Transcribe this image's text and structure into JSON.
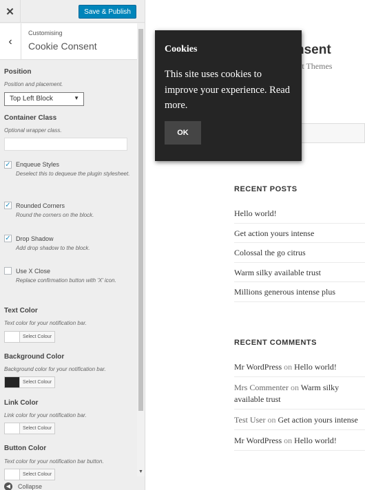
{
  "topbar": {
    "publish_label": "Save & Publish"
  },
  "header": {
    "crumb": "Customising",
    "title": "Cookie Consent"
  },
  "position": {
    "title": "Position",
    "desc": "Position and placement.",
    "selected": "Top Left Block"
  },
  "container_class": {
    "title": "Container Class",
    "desc": "Optional wrapper class.",
    "value": ""
  },
  "checkboxes": [
    {
      "label": "Enqueue Styles",
      "desc": "Deselect this to dequeue the plugin stylesheet.",
      "checked": true
    },
    {
      "label": "Rounded Corners",
      "desc": "Round the corners on the block.",
      "checked": true
    },
    {
      "label": "Drop Shadow",
      "desc": "Add drop shadow to the block.",
      "checked": true
    },
    {
      "label": "Use X Close",
      "desc": "Replace confirmation button with 'X' icon.",
      "checked": false
    }
  ],
  "colors": [
    {
      "title": "Text Color",
      "desc": "Text color for your notification bar.",
      "button": "Select Colour",
      "value": "#ffffff"
    },
    {
      "title": "Background Color",
      "desc": "Background color for your notification bar.",
      "button": "Select Colour",
      "value": "#252525"
    },
    {
      "title": "Link Color",
      "desc": "Link color for your notification bar.",
      "button": "Select Colour",
      "value": "#ffffff"
    },
    {
      "title": "Button Color",
      "desc": "Text color for your notification bar button.",
      "button": "Select Colour",
      "value": "#ffffff"
    }
  ],
  "collapse_label": "Collapse",
  "site": {
    "title": "nsent",
    "desc": "ult Themes"
  },
  "recent_posts": {
    "title": "RECENT POSTS",
    "items": [
      "Hello world!",
      "Get action yours intense",
      "Colossal the go citrus",
      "Warm silky available trust",
      "Millions generous intense plus"
    ]
  },
  "recent_comments": {
    "title": "RECENT COMMENTS",
    "items": [
      {
        "author": "Mr WordPress",
        "on": " on ",
        "post": "Hello world!"
      },
      {
        "author": "Mrs Commenter",
        "on": " on ",
        "post": "Warm silky available trust"
      },
      {
        "author": "Test User",
        "on": " on ",
        "post": "Get action yours intense"
      },
      {
        "author": "Mr WordPress",
        "on": " on ",
        "post": "Hello world!"
      }
    ]
  },
  "cookie": {
    "title": "Cookies",
    "text": "This site uses cookies to improve your experience. Read more.",
    "button": "OK"
  },
  "colors_theme": {
    "accent": "#0085ba",
    "popup_bg": "#252525",
    "checkbox": "#1e8cbe"
  }
}
